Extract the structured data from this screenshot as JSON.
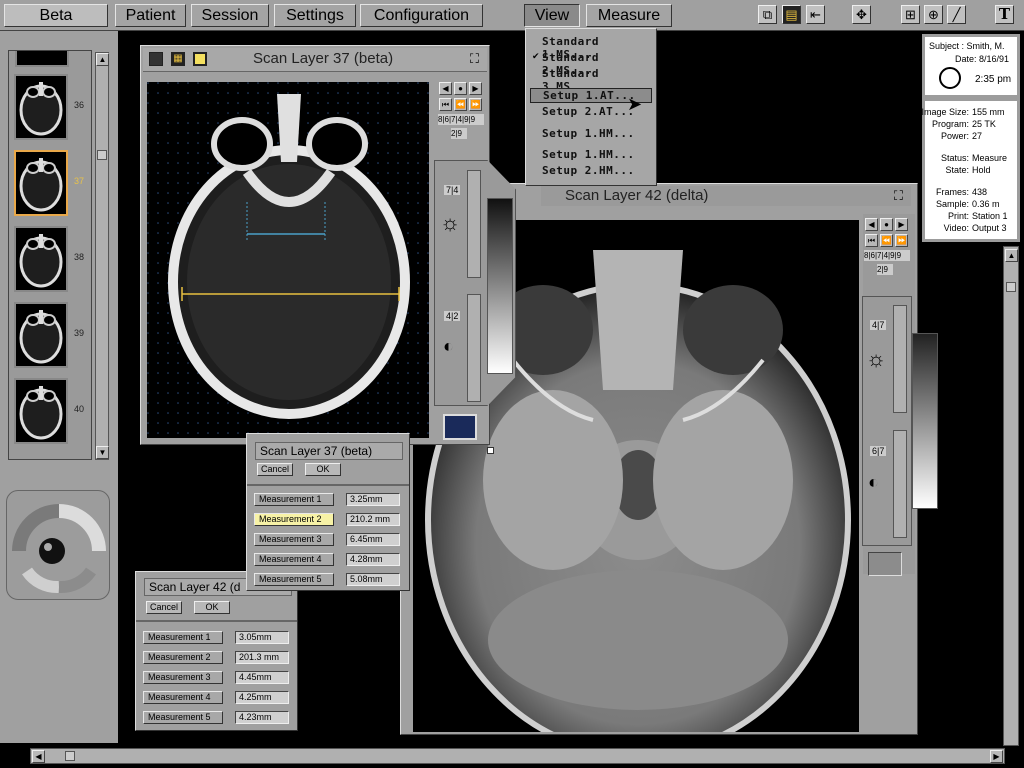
{
  "menubar": {
    "app_label": "Beta",
    "items": [
      "Patient",
      "Session",
      "Settings",
      "Configuration"
    ],
    "view": "View",
    "measure": "Measure"
  },
  "toolbar": {
    "icons": [
      "copy-icon",
      "film-icon",
      "step-back-icon",
      "move-icon",
      "zoom-in-icon",
      "target-icon",
      "line-tool-icon",
      "text-tool-icon"
    ],
    "text_tool_label": "T"
  },
  "view_menu": {
    "items": [
      "Standard 1.MS...",
      "Standard 2.MS...",
      "Standard 3.MS...",
      "Setup 1.AT...",
      "Setup 2.AT...",
      "Setup 1.HM...",
      "Setup 1.HM...",
      "Setup 2.HM..."
    ],
    "checked_index": 1,
    "highlighted_index": 3
  },
  "thumbnails": {
    "items": [
      {
        "label": "36",
        "selected": false
      },
      {
        "label": "37",
        "selected": true
      },
      {
        "label": "38",
        "selected": false
      },
      {
        "label": "39",
        "selected": false
      },
      {
        "label": "40",
        "selected": false
      }
    ]
  },
  "window_a": {
    "title": "Scan Layer 37  (beta)",
    "frame_counter": "8|6|7|4|9|9",
    "slice": "2|9",
    "brightness": "7|4",
    "contrast": "4|2"
  },
  "window_b": {
    "title": "Scan Layer 42  (delta)",
    "frame_counter": "8|6|7|4|9|9",
    "slice": "2|9",
    "brightness": "4|7",
    "contrast": "6|7"
  },
  "patient_info": {
    "subject_label": "Subject :",
    "subject": "Smith, M.",
    "date_label": "Date:",
    "date": "8/16/91",
    "time": "2:35 pm"
  },
  "image_info": {
    "rows": [
      {
        "label": "Image Size:",
        "value": "155 mm"
      },
      {
        "label": "Program:",
        "value": "25 TK"
      },
      {
        "label": "Power:",
        "value": "27"
      },
      {
        "label": "Status:",
        "value": "Measure"
      },
      {
        "label": "State:",
        "value": "Hold"
      },
      {
        "label": "Frames:",
        "value": "438"
      },
      {
        "label": "Sample:",
        "value": "0.36 m"
      },
      {
        "label": "Print:",
        "value": "Station 1"
      },
      {
        "label": "Video:",
        "value": "Output 3"
      }
    ]
  },
  "dialog_a": {
    "title": "Scan Layer 37 (beta)",
    "cancel": "Cancel",
    "ok": "OK",
    "measurements": [
      {
        "label": "Measurement 1",
        "value": "3.25mm"
      },
      {
        "label": "Measurement 2",
        "value": "210.2 mm"
      },
      {
        "label": "Measurement 3",
        "value": "6.45mm"
      },
      {
        "label": "Measurement 4",
        "value": "4.28mm"
      },
      {
        "label": "Measurement 5",
        "value": "5.08mm"
      }
    ],
    "highlighted_index": 1
  },
  "dialog_b": {
    "title": "Scan Layer 42 (d",
    "cancel": "Cancel",
    "ok": "OK",
    "measurements": [
      {
        "label": "Measurement 1",
        "value": "3.05mm"
      },
      {
        "label": "Measurement 2",
        "value": "201.3 mm"
      },
      {
        "label": "Measurement 3",
        "value": "4.45mm"
      },
      {
        "label": "Measurement 4",
        "value": "4.25mm"
      },
      {
        "label": "Measurement 5",
        "value": "4.23mm"
      }
    ]
  },
  "colors": {
    "panel": "#a0a0a0",
    "highlight_yellow": "#f7f2a6",
    "selection_orange": "#e8a84a",
    "measure_yellow": "#e8c040",
    "measure_cyan": "#4aa0c8"
  }
}
